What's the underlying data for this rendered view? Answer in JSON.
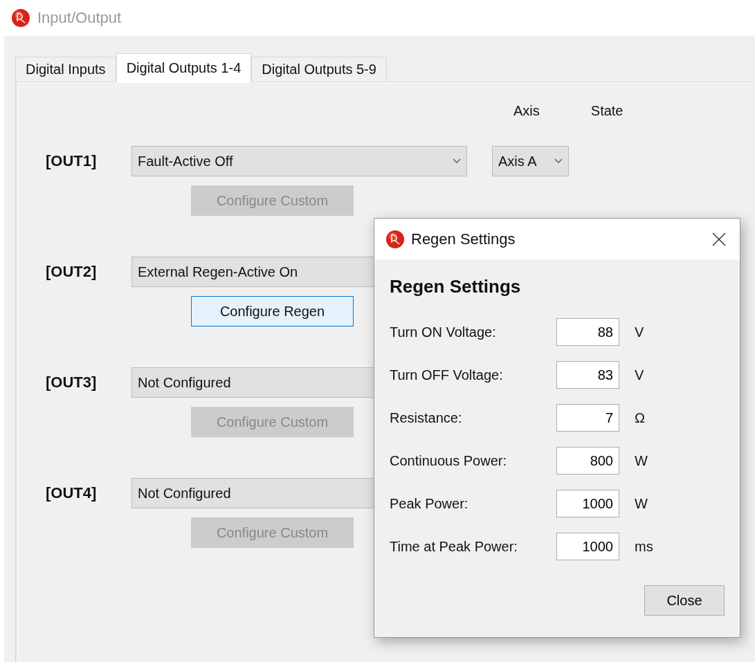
{
  "window": {
    "title": "Input/Output"
  },
  "tabs": [
    {
      "label": "Digital Inputs",
      "selected": false
    },
    {
      "label": "Digital Outputs 1-4",
      "selected": true
    },
    {
      "label": "Digital Outputs 5-9",
      "selected": false
    }
  ],
  "headers": {
    "axis": "Axis",
    "state": "State"
  },
  "outputs": [
    {
      "label": "[OUT1]",
      "function": "Fault-Active Off",
      "chevron_visible": true,
      "axis": "Axis A",
      "button": {
        "label": "Configure Custom",
        "disabled": true,
        "focused": false
      }
    },
    {
      "label": "[OUT2]",
      "function": "External Regen-Active On",
      "button": {
        "label": "Configure Regen",
        "disabled": false,
        "focused": true
      }
    },
    {
      "label": "[OUT3]",
      "function": "Not Configured",
      "button": {
        "label": "Configure Custom",
        "disabled": true,
        "focused": false
      }
    },
    {
      "label": "[OUT4]",
      "function": "Not Configured",
      "button": {
        "label": "Configure Custom",
        "disabled": true,
        "focused": false
      }
    }
  ],
  "dialog": {
    "title": "Regen Settings",
    "heading": "Regen Settings",
    "fields": [
      {
        "label": "Turn ON Voltage:",
        "value": "88",
        "unit": "V"
      },
      {
        "label": "Turn OFF Voltage:",
        "value": "83",
        "unit": "V"
      },
      {
        "label": "Resistance:",
        "value": "7",
        "unit": "Ω"
      },
      {
        "label": "Continuous Power:",
        "value": "800",
        "unit": "W"
      },
      {
        "label": "Peak Power:",
        "value": "1000",
        "unit": "W"
      },
      {
        "label": "Time at Peak Power:",
        "value": "1000",
        "unit": "ms"
      }
    ],
    "close_button": "Close"
  }
}
